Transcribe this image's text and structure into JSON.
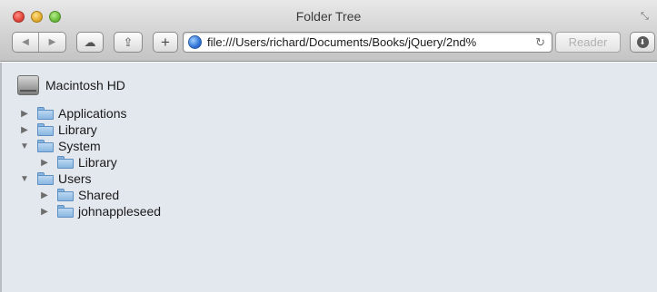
{
  "window": {
    "title": "Folder Tree"
  },
  "toolbar": {
    "back_icon": "◀",
    "forward_icon": "▶",
    "cloud_icon": "☁",
    "share_icon": "⇪",
    "plus_label": "+",
    "url": "file:///Users/richard/Documents/Books/jQuery/2nd%",
    "reload_icon": "↻",
    "reader_label": "Reader",
    "download_icon": "⬇",
    "resize_icon": "⤡"
  },
  "drive": {
    "label": "Macintosh HD"
  },
  "tree": [
    {
      "label": "Applications",
      "expanded": false,
      "depth": 0
    },
    {
      "label": "Library",
      "expanded": false,
      "depth": 0
    },
    {
      "label": "System",
      "expanded": true,
      "depth": 0
    },
    {
      "label": "Library",
      "expanded": false,
      "depth": 1
    },
    {
      "label": "Users",
      "expanded": true,
      "depth": 0
    },
    {
      "label": "Shared",
      "expanded": false,
      "depth": 1
    },
    {
      "label": "johnappleseed",
      "expanded": false,
      "depth": 1
    }
  ],
  "arrows": {
    "collapsed": "▶",
    "expanded": "▼"
  }
}
